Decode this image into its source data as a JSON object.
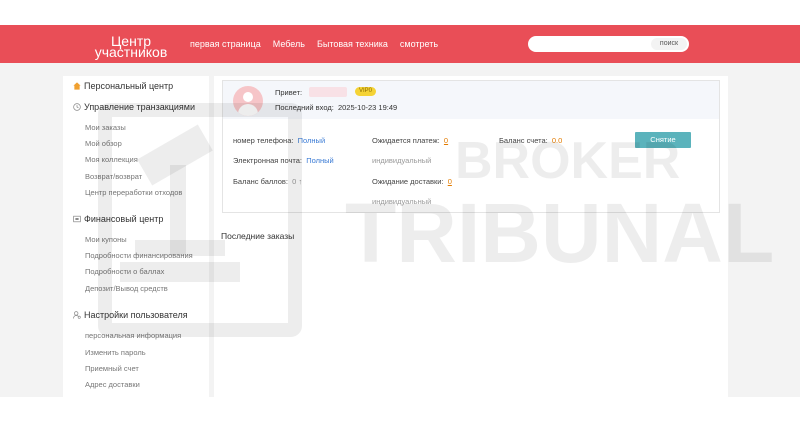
{
  "header": {
    "logo_line1": "Центр",
    "logo_line2": "участников",
    "nav": [
      "первая страница",
      "Мебель",
      "Бытовая техника",
      "смотреть"
    ],
    "search": {
      "placeholder": "",
      "button_label": "поиск"
    },
    "accent_color": "#e94e57"
  },
  "sidebar": {
    "personal_center": "Персональный центр",
    "sections": [
      {
        "title": "Управление транзакциями",
        "icon": "clock-icon",
        "items": [
          "Мои заказы",
          "Мой обзор",
          "Моя коллекция",
          "Возврат/возврат",
          "Центр переработки отходов"
        ]
      },
      {
        "title": "Финансовый центр",
        "icon": "wallet-icon",
        "items": [
          "Мои купоны",
          "Подробности финансирования",
          "Подробности о баллах",
          "Депозит/Вывод средств"
        ]
      },
      {
        "title": "Настройки пользователя",
        "icon": "user-settings-icon",
        "items": [
          "персональная информация",
          "Изменить пароль",
          "Приемный счет",
          "Адрес доставки"
        ]
      }
    ]
  },
  "profile": {
    "greeting": "Привет:",
    "vip_badge": "VIP0",
    "last_login_label": "Последний вход:",
    "last_login_value": "2025-10-23 19:49"
  },
  "account": {
    "phone_label": "номер телефона:",
    "phone_value": "Полный",
    "email_label": "Электронная почта:",
    "email_value": "Полный",
    "points_label": "Баланс баллов:",
    "points_value": "0",
    "pending_payment_label": "Ожидается платеж:",
    "pending_payment_value": "0",
    "individual_1": "индивидуальный",
    "pending_delivery_label": "Ожидание доставки:",
    "pending_delivery_value": "0",
    "individual_2": "индивидуальный",
    "balance_label": "Баланс счета:",
    "balance_value": "0.0",
    "withdraw_button": "Снятие"
  },
  "recent_orders_title": "Последние заказы",
  "watermark": {
    "line1": "BROKER",
    "line2": "TRIBUNAL"
  }
}
